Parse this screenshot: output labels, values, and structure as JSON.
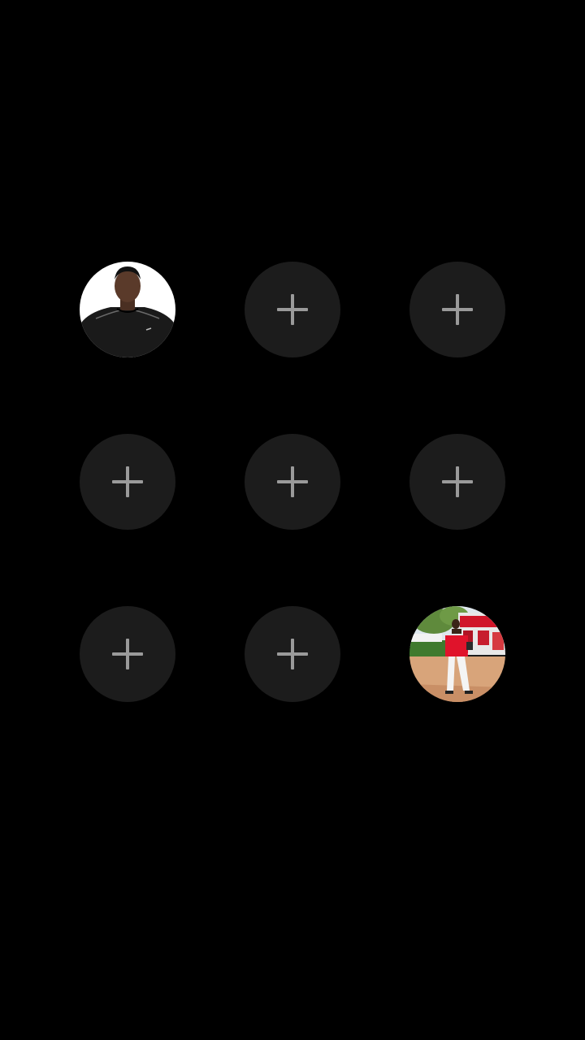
{
  "grid": {
    "slots": [
      {
        "state": "filled",
        "icon": "avatar-photo-man-black-shirt"
      },
      {
        "state": "empty",
        "icon": "plus-icon"
      },
      {
        "state": "empty",
        "icon": "plus-icon"
      },
      {
        "state": "empty",
        "icon": "plus-icon"
      },
      {
        "state": "empty",
        "icon": "plus-icon"
      },
      {
        "state": "empty",
        "icon": "plus-icon"
      },
      {
        "state": "empty",
        "icon": "plus-icon"
      },
      {
        "state": "empty",
        "icon": "plus-icon"
      },
      {
        "state": "filled",
        "icon": "avatar-photo-man-red-shirt-field"
      }
    ]
  },
  "colors": {
    "background": "#000000",
    "slot_background": "#1c1c1c",
    "plus": "#9a9a9a"
  }
}
